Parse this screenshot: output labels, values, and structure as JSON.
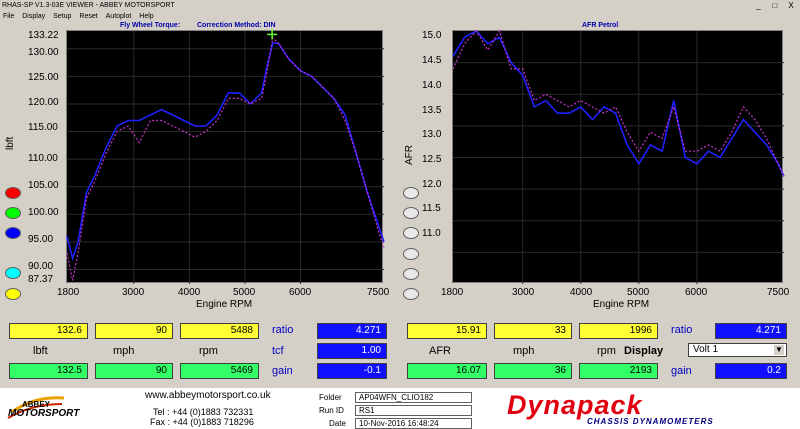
{
  "window": {
    "title": "RHAS-SP V1.3-03E VIEWER - ABBEY MOTORSPORT",
    "controls": [
      "_",
      "□",
      "X"
    ]
  },
  "menu": [
    "File",
    "Display",
    "Setup",
    "Reset",
    "Autoplot",
    "Help"
  ],
  "left_chart": {
    "title": "Fly Wheel Torque:",
    "correction": "Correction Method: DIN",
    "ylabel": "lbft",
    "xlabel": "Engine RPM",
    "y_ticks": [
      "133.22",
      "130.00",
      "125.00",
      "120.00",
      "115.00",
      "110.00",
      "105.00",
      "100.00",
      "95.00",
      "90.00",
      "87.37"
    ],
    "x_ticks": [
      "1800",
      "3000",
      "4000",
      "5000",
      "6000",
      "7500"
    ]
  },
  "right_chart": {
    "title": "AFR Petrol",
    "ylabel": "AFR",
    "xlabel": "Engine RPM",
    "y_ticks": [
      "15.0",
      "14.5",
      "14.0",
      "13.5",
      "13.0",
      "12.5",
      "12.0",
      "11.5",
      "11.0"
    ],
    "x_ticks": [
      "1800",
      "3000",
      "4000",
      "5000",
      "6000",
      "7500"
    ]
  },
  "legend_left": [
    "#ff0000",
    "#00ff00",
    "#0000ff",
    "#00ffff",
    "#ffff00"
  ],
  "legend_right": [
    "#e8e8e8",
    "#e8e8e8",
    "#e8e8e8",
    "#e8e8e8",
    "#e8e8e8",
    "#e8e8e8"
  ],
  "left_panel": {
    "row1": [
      "132.6",
      "90",
      "5488"
    ],
    "units": [
      "lbft",
      "mph",
      "rpm"
    ],
    "row2": [
      "132.5",
      "90",
      "5469"
    ],
    "ratio_label": "ratio",
    "ratio_value": "4.271",
    "tcf_label": "tcf",
    "tcf_value": "1.00",
    "gain_label": "gain",
    "gain_value": "-0.1"
  },
  "right_panel": {
    "row1": [
      "15.91",
      "33",
      "1996"
    ],
    "units": [
      "AFR",
      "mph",
      "rpm"
    ],
    "row2": [
      "16.07",
      "36",
      "2193"
    ],
    "display_label": "Display",
    "display_value": "Volt 1",
    "ratio_label": "ratio",
    "ratio_value": "4.271",
    "gain_label": "gain",
    "gain_value": "0.2"
  },
  "footer": {
    "abbey_line1": "ABBEY",
    "abbey_line2": "MOTORSPORT",
    "website": "www.abbeymotorsport.co.uk",
    "tel": "Tel : +44 (0)1883 732331",
    "fax": "Fax : +44 (0)1883 718296",
    "folder_label": "Folder",
    "folder_value": "AP04WFN_CLIO182",
    "run_label": "Run ID",
    "run_value": "RS1",
    "date_label": "Date",
    "date_value": "10-Nov-2016  16:48:24",
    "dynapack": "Dynapack",
    "dynapack_sub": "CHASSIS DYNAMOMETERS"
  },
  "chart_data": [
    {
      "type": "line",
      "title": "Fly Wheel Torque:",
      "xlabel": "Engine RPM",
      "ylabel": "lbft",
      "xlim": [
        1800,
        7500
      ],
      "ylim": [
        87.37,
        133.22
      ],
      "series": [
        {
          "color": "#2020ff",
          "x": [
            1800,
            1900,
            2000,
            2150,
            2300,
            2500,
            2700,
            2900,
            3100,
            3300,
            3500,
            3700,
            3900,
            4100,
            4300,
            4500,
            4700,
            4900,
            5100,
            5300,
            5400,
            5500,
            5600,
            5800,
            6000,
            6200,
            6400,
            6600,
            6800,
            7000,
            7200,
            7400,
            7500
          ],
          "y": [
            96,
            92,
            95,
            104,
            107,
            112,
            116,
            117,
            117,
            118,
            119,
            118,
            117,
            116,
            116,
            118,
            122,
            122,
            120,
            122,
            127,
            131,
            131,
            128,
            126,
            125,
            123,
            121,
            118,
            111,
            104,
            98,
            95
          ]
        },
        {
          "color": "#cc33cc",
          "x": [
            1800,
            1900,
            2000,
            2150,
            2300,
            2500,
            2700,
            2900,
            3100,
            3300,
            3500,
            3700,
            3900,
            4100,
            4300,
            4500,
            4700,
            4900,
            5100,
            5300,
            5400,
            5500,
            5600,
            5800,
            6000,
            6200,
            6400,
            6600,
            6800,
            7000,
            7200,
            7400,
            7500
          ],
          "y": [
            93,
            88,
            93,
            103,
            106,
            111,
            115,
            116,
            113,
            117,
            117,
            116,
            115,
            114,
            115,
            117,
            121,
            121,
            120,
            121,
            126,
            132,
            131,
            128,
            126,
            125,
            123,
            121,
            117,
            111,
            104,
            97,
            94
          ]
        }
      ]
    },
    {
      "type": "line",
      "title": "AFR Petrol",
      "xlabel": "Engine RPM",
      "ylabel": "AFR",
      "xlim": [
        1800,
        7500
      ],
      "ylim": [
        11.0,
        15.0
      ],
      "series": [
        {
          "color": "#2020ff",
          "x": [
            1800,
            2000,
            2200,
            2400,
            2600,
            2800,
            3000,
            3200,
            3400,
            3600,
            3800,
            4000,
            4200,
            4400,
            4600,
            4800,
            5000,
            5200,
            5400,
            5600,
            5800,
            6000,
            6200,
            6400,
            6600,
            6800,
            7000,
            7200,
            7400,
            7500
          ],
          "y": [
            14.6,
            14.9,
            15.0,
            14.8,
            14.9,
            14.5,
            14.3,
            13.8,
            13.9,
            13.7,
            13.7,
            13.8,
            13.6,
            13.8,
            13.7,
            13.2,
            12.9,
            13.2,
            13.1,
            13.9,
            13.0,
            12.9,
            13.1,
            13.0,
            13.3,
            13.6,
            13.4,
            13.2,
            12.9,
            12.7
          ]
        },
        {
          "color": "#cc33cc",
          "x": [
            1800,
            2000,
            2200,
            2400,
            2600,
            2800,
            3000,
            3200,
            3400,
            3600,
            3800,
            4000,
            4200,
            4400,
            4600,
            4800,
            5000,
            5200,
            5400,
            5600,
            5800,
            6000,
            6200,
            6400,
            6600,
            6800,
            7000,
            7200,
            7400,
            7500
          ],
          "y": [
            14.4,
            14.8,
            15.0,
            14.7,
            15.0,
            14.4,
            14.4,
            13.9,
            14.0,
            13.9,
            13.8,
            13.9,
            13.8,
            13.7,
            13.8,
            13.4,
            13.1,
            13.4,
            13.3,
            13.8,
            13.1,
            13.1,
            13.2,
            13.1,
            13.4,
            13.8,
            13.6,
            13.3,
            12.9,
            12.7
          ]
        }
      ]
    }
  ]
}
